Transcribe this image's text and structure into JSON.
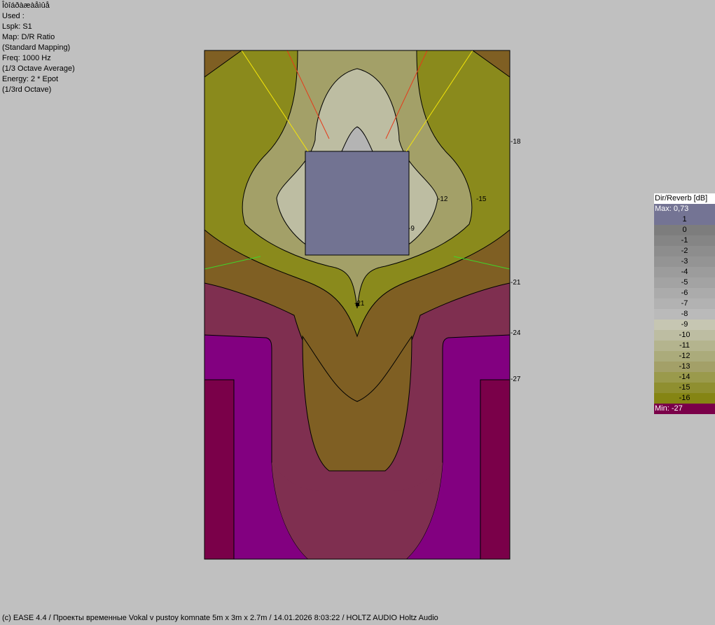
{
  "info": {
    "lines": [
      "Îòîáðàæàåìûå",
      "Used :",
      "Lspk: S1",
      "Map: D/R Ratio",
      "(Standard Mapping)",
      "Freq: 1000 Hz",
      "(1/3 Octave Average)",
      "Energy: 2 * Epot",
      "(1/3rd Octave)"
    ]
  },
  "plot": {
    "contour_labels": [
      "-18",
      "-12",
      "-15",
      "-9",
      "-21",
      "-24",
      "-27",
      "-21"
    ],
    "colors": {
      "outer_brown": "#7f5f23",
      "olive_dark": "#8a8a1c",
      "olive_light": "#a3a068",
      "pale": "#bdbda2",
      "grey_light": "#b4b4b4",
      "stage_box": "#727392",
      "wine": "#7f2f50",
      "purple": "#820080",
      "deep": "#7a0049",
      "ray_yellow": "#f5e60a",
      "ray_red": "#e53a1a",
      "ray_green": "#3fd62a",
      "frame": "#000000"
    }
  },
  "legend": {
    "title": "Dir/Reverb [dB]",
    "max_label": "Max:  0,73",
    "min_label": "Min:  -27",
    "max_color": "#747494",
    "min_color": "#7a0049",
    "rows": [
      {
        "label": "1",
        "color": "#747494"
      },
      {
        "label": "0",
        "color": "#7d7d7d"
      },
      {
        "label": "-1",
        "color": "#858585"
      },
      {
        "label": "-2",
        "color": "#8d8d8d"
      },
      {
        "label": "-3",
        "color": "#949494"
      },
      {
        "label": "-4",
        "color": "#9c9c9c"
      },
      {
        "label": "-5",
        "color": "#a3a3a3"
      },
      {
        "label": "-6",
        "color": "#ababab"
      },
      {
        "label": "-7",
        "color": "#b2b2b2"
      },
      {
        "label": "-8",
        "color": "#bababa"
      },
      {
        "label": "-9",
        "color": "#c6c6b2"
      },
      {
        "label": "-10",
        "color": "#bdbda2"
      },
      {
        "label": "-11",
        "color": "#b4b48e"
      },
      {
        "label": "-12",
        "color": "#abab7b"
      },
      {
        "label": "-13",
        "color": "#a3a068"
      },
      {
        "label": "-14",
        "color": "#9a9a4c"
      },
      {
        "label": "-15",
        "color": "#8f8f30"
      },
      {
        "label": "-16",
        "color": "#858513"
      }
    ]
  },
  "footer": {
    "text": "(c) EASE 4.4  / Проекты временные Vokal v pustoy komnate 5m x 3m x 2.7m / 14.01.2026 8:03:22 / HOLTZ AUDIO Holtz Audio"
  }
}
